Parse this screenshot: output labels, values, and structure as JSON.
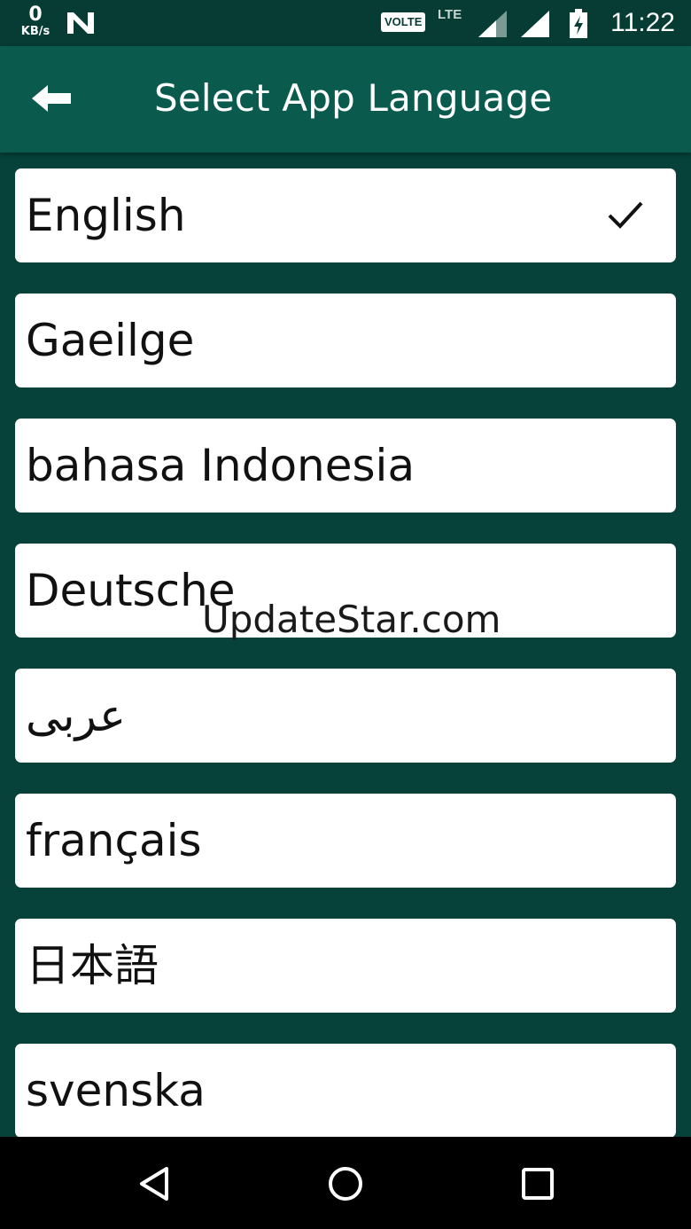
{
  "status_bar": {
    "speed_value": "0",
    "speed_unit": "KB/s",
    "volte": "VOLTE",
    "lte": "LTE",
    "time": "11:22"
  },
  "app_bar": {
    "title": "Select App Language"
  },
  "languages": [
    {
      "label": "English",
      "selected": true
    },
    {
      "label": "Gaeilge",
      "selected": false
    },
    {
      "label": "bahasa Indonesia",
      "selected": false
    },
    {
      "label": "Deutsche",
      "selected": false
    },
    {
      "label": "عربى",
      "selected": false
    },
    {
      "label": "français",
      "selected": false
    },
    {
      "label": "日本語",
      "selected": false
    },
    {
      "label": "svenska",
      "selected": false
    }
  ],
  "watermark": "UpdateStar.com",
  "colors": {
    "status_bar": "#063c34",
    "app_bar": "#0a5a4e",
    "background": "#06413a",
    "card": "#ffffff"
  }
}
